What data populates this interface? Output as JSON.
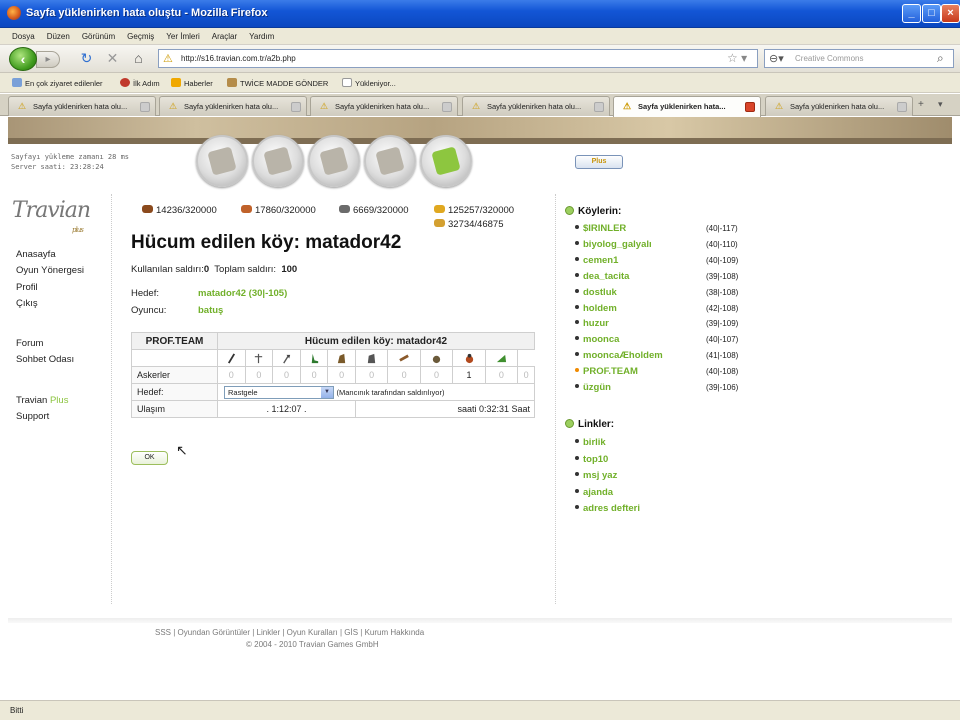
{
  "window": {
    "title": "Sayfa yüklenirken hata oluştu - Mozilla Firefox"
  },
  "menu": [
    "Dosya",
    "Düzen",
    "Görünüm",
    "Geçmiş",
    "Yer İmleri",
    "Araçlar",
    "Yardım"
  ],
  "url": "http://s16.travian.com.tr/a2b.php",
  "search_placeholder": "Creative Commons",
  "bookmarks": [
    "En çok ziyaret edilenler",
    "İlk Adım",
    "Haberler",
    "TWİCE MADDE GÖNDER",
    "Yükleniyor..."
  ],
  "tabs": [
    {
      "label": "Sayfa yüklenirken hata olu...",
      "active": false
    },
    {
      "label": "Sayfa yüklenirken hata olu...",
      "active": false
    },
    {
      "label": "Sayfa yüklenirken hata olu...",
      "active": false
    },
    {
      "label": "Sayfa yüklenirken hata olu...",
      "active": false
    },
    {
      "label": "Sayfa yüklenirken hata...",
      "active": true
    },
    {
      "label": "Sayfa yüklenirken hata olu...",
      "active": false
    }
  ],
  "server": {
    "load_time": "Sayfayı yükleme zamanı 28 ms",
    "server_time": "Server saati: 23:28:24"
  },
  "plus_button": "Plus",
  "logo": {
    "text": "Travian",
    "sub": "plus"
  },
  "left_nav": [
    "Anasayfa",
    "Oyun Yönergesi",
    "Profil",
    "Çıkış",
    "Forum",
    "Sohbet Odası",
    "Travian",
    "Plus",
    "Support"
  ],
  "resources": {
    "wood": "14236/320000",
    "clay": "17860/320000",
    "iron": "6669/320000",
    "crop": "125257/320000",
    "consumption": "32734/46875"
  },
  "heading": "Hücum edilen köy: matador42",
  "info": {
    "used_label": "Kullanılan saldırı:",
    "used_value": "0",
    "total_label": "Toplam saldırı:",
    "total_value": "100"
  },
  "target": {
    "label": "Hedef:",
    "value": "matador42 (30|-105)"
  },
  "player": {
    "label": "Oyuncu:",
    "value": "batuş"
  },
  "troops": {
    "own_label": "PROF.TEAM",
    "target_header": "Hücum edilen köy: matador42",
    "row_soldiers": "Askerler",
    "counts": [
      "0",
      "0",
      "0",
      "0",
      "0",
      "0",
      "0",
      "0",
      "1",
      "0",
      "0"
    ],
    "row_target": "Hedef:",
    "select_value": "Rastgele",
    "catapult_note": "(Mancınık tarafından saldırılıyor)",
    "row_arrival": "Ulaşım",
    "duration": ". 1:12:07 .",
    "arrival": "saati 0:32:31 Saat"
  },
  "ok_button": "OK",
  "villages_title": "Köylerin:",
  "villages": [
    {
      "name": "$IRINLER",
      "coord": "(40|-117)",
      "active": false
    },
    {
      "name": "biyolog_galyalı",
      "coord": "(40|-110)",
      "active": false
    },
    {
      "name": "cemen1",
      "coord": "(40|-109)",
      "active": false
    },
    {
      "name": "dea_tacita",
      "coord": "(39|-108)",
      "active": false
    },
    {
      "name": "dostluk",
      "coord": "(38|-108)",
      "active": false
    },
    {
      "name": "holdem",
      "coord": "(42|-108)",
      "active": false
    },
    {
      "name": "huzur",
      "coord": "(39|-109)",
      "active": false
    },
    {
      "name": "moonca",
      "coord": "(40|-107)",
      "active": false
    },
    {
      "name": "mooncaÆholdem",
      "coord": "(41|-108)",
      "active": false
    },
    {
      "name": "PROF.TEAM",
      "coord": "(40|-108)",
      "active": true
    },
    {
      "name": "üzgün",
      "coord": "(39|-106)",
      "active": false
    }
  ],
  "links_title": "Linkler:",
  "links": [
    "birlik",
    "top10",
    "msj yaz",
    "ajanda",
    "adres defteri"
  ],
  "footer": {
    "links": "SSS | Oyundan Görüntüler | Linkler | Oyun Kuralları | GİS | Kurum Hakkında",
    "copyright": "© 2004 - 2010 Travian Games GmbH"
  },
  "status": "Bitti"
}
